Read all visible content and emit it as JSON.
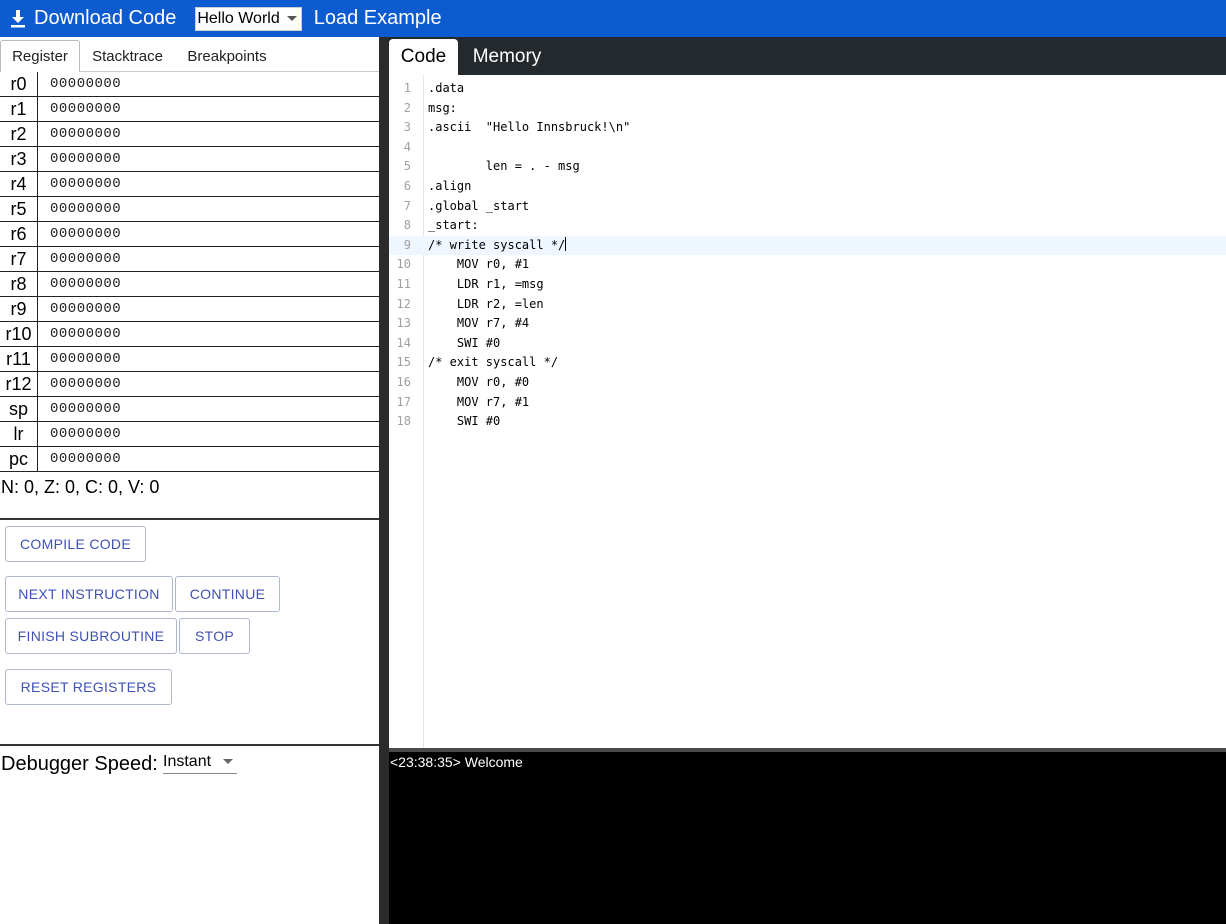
{
  "toolbar": {
    "download_label": "Download Code",
    "example_value": "Hello World",
    "load_label": "Load Example"
  },
  "left_tabs": [
    "Register",
    "Stacktrace",
    "Breakpoints"
  ],
  "registers": [
    {
      "name": "r0",
      "value": "00000000"
    },
    {
      "name": "r1",
      "value": "00000000"
    },
    {
      "name": "r2",
      "value": "00000000"
    },
    {
      "name": "r3",
      "value": "00000000"
    },
    {
      "name": "r4",
      "value": "00000000"
    },
    {
      "name": "r5",
      "value": "00000000"
    },
    {
      "name": "r6",
      "value": "00000000"
    },
    {
      "name": "r7",
      "value": "00000000"
    },
    {
      "name": "r8",
      "value": "00000000"
    },
    {
      "name": "r9",
      "value": "00000000"
    },
    {
      "name": "r10",
      "value": "00000000"
    },
    {
      "name": "r11",
      "value": "00000000"
    },
    {
      "name": "r12",
      "value": "00000000"
    },
    {
      "name": "sp",
      "value": "00000000"
    },
    {
      "name": "lr",
      "value": "00000000"
    },
    {
      "name": "pc",
      "value": "00000000"
    }
  ],
  "flags": "N: 0, Z: 0, C: 0, V: 0",
  "buttons": {
    "compile": "COMPILE CODE",
    "next": "NEXT INSTRUCTION",
    "continue": "CONTINUE",
    "finish": "FINISH SUBROUTINE",
    "stop": "STOP",
    "reset": "RESET REGISTERS"
  },
  "speed": {
    "label": "Debugger Speed:",
    "value": "Instant"
  },
  "right_tabs": [
    "Code",
    "Memory"
  ],
  "code_lines": [
    ".data",
    "msg:",
    ".ascii  \"Hello Innsbruck!\\n\"",
    "",
    "        len = . - msg",
    ".align",
    ".global _start",
    "_start:",
    "/* write syscall */",
    "    MOV r0, #1",
    "    LDR r1, =msg",
    "    LDR r2, =len",
    "    MOV r7, #4",
    "    SWI #0",
    "/* exit syscall */",
    "    MOV r0, #0",
    "    MOV r7, #1",
    "    SWI #0"
  ],
  "current_line": 9,
  "console": "<23:38:35> Welcome"
}
